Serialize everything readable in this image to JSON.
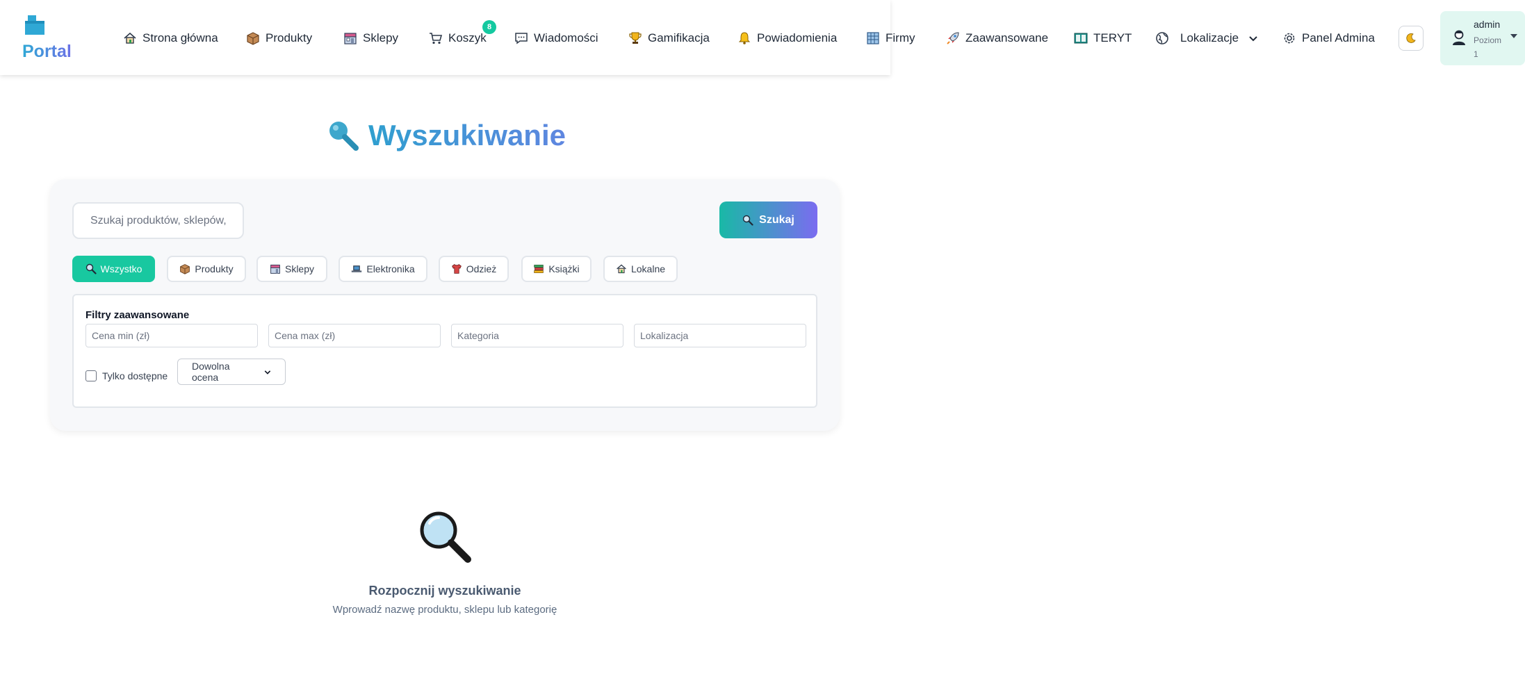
{
  "navbar": {
    "brand": "Portal",
    "items": [
      {
        "label": "Strona główna",
        "icon": "home-icon"
      },
      {
        "label": "Produkty",
        "icon": "box-icon"
      },
      {
        "label": "Sklepy",
        "icon": "store-icon"
      },
      {
        "label": "Koszyk",
        "icon": "cart-icon"
      },
      {
        "label": "Wiadomości",
        "icon": "chat-icon"
      },
      {
        "label": "Gamifikacja",
        "icon": "trophy-icon"
      },
      {
        "label": "Powiadomienia",
        "icon": "bell-icon"
      },
      {
        "label": "Firmy",
        "icon": "building-icon"
      },
      {
        "label": "Zaawansowane",
        "icon": "rocket-icon"
      },
      {
        "label": "TERYT",
        "icon": "map-book-icon"
      },
      {
        "label": "Lokalizacje",
        "icon": "globe-icon"
      },
      {
        "label": "Panel Admina",
        "icon": "gear-icon"
      }
    ],
    "cart_badge": "8",
    "theme_icon": "moon-icon",
    "user": {
      "name": "admin",
      "level": "Poziom 1"
    }
  },
  "page": {
    "title": "Wyszukiwanie"
  },
  "search": {
    "placeholder": "Szukaj produktów, sklepów,",
    "button_label": "Szukaj"
  },
  "categories": [
    {
      "label": "Wszystko",
      "icon": "search-icon",
      "active": true
    },
    {
      "label": "Produkty",
      "icon": "box-icon"
    },
    {
      "label": "Sklepy",
      "icon": "store-icon"
    },
    {
      "label": "Elektronika",
      "icon": "laptop-icon"
    },
    {
      "label": "Odzież",
      "icon": "shirt-icon"
    },
    {
      "label": "Książki",
      "icon": "books-icon"
    },
    {
      "label": "Lokalne",
      "icon": "house-icon"
    }
  ],
  "filters": {
    "title": "Filtry zaawansowane",
    "price_min_placeholder": "Cena min (zł)",
    "price_max_placeholder": "Cena max (zł)",
    "category_placeholder": "Kategoria",
    "location_placeholder": "Lokalizacja",
    "available_only_label": "Tylko dostępne",
    "rating_selected": "Dowolna ocena"
  },
  "empty_state": {
    "title": "Rozpocznij wyszukiwanie",
    "subtitle": "Wprowadź nazwę produktu, sklepu lub kategorię"
  },
  "colors": {
    "accent": "#18c8a0",
    "title_gradient_start": "#2f9fcf",
    "title_gradient_end": "#5f86e0",
    "button_gradient_start": "#19b9a6",
    "button_gradient_end": "#7b6cf0"
  }
}
